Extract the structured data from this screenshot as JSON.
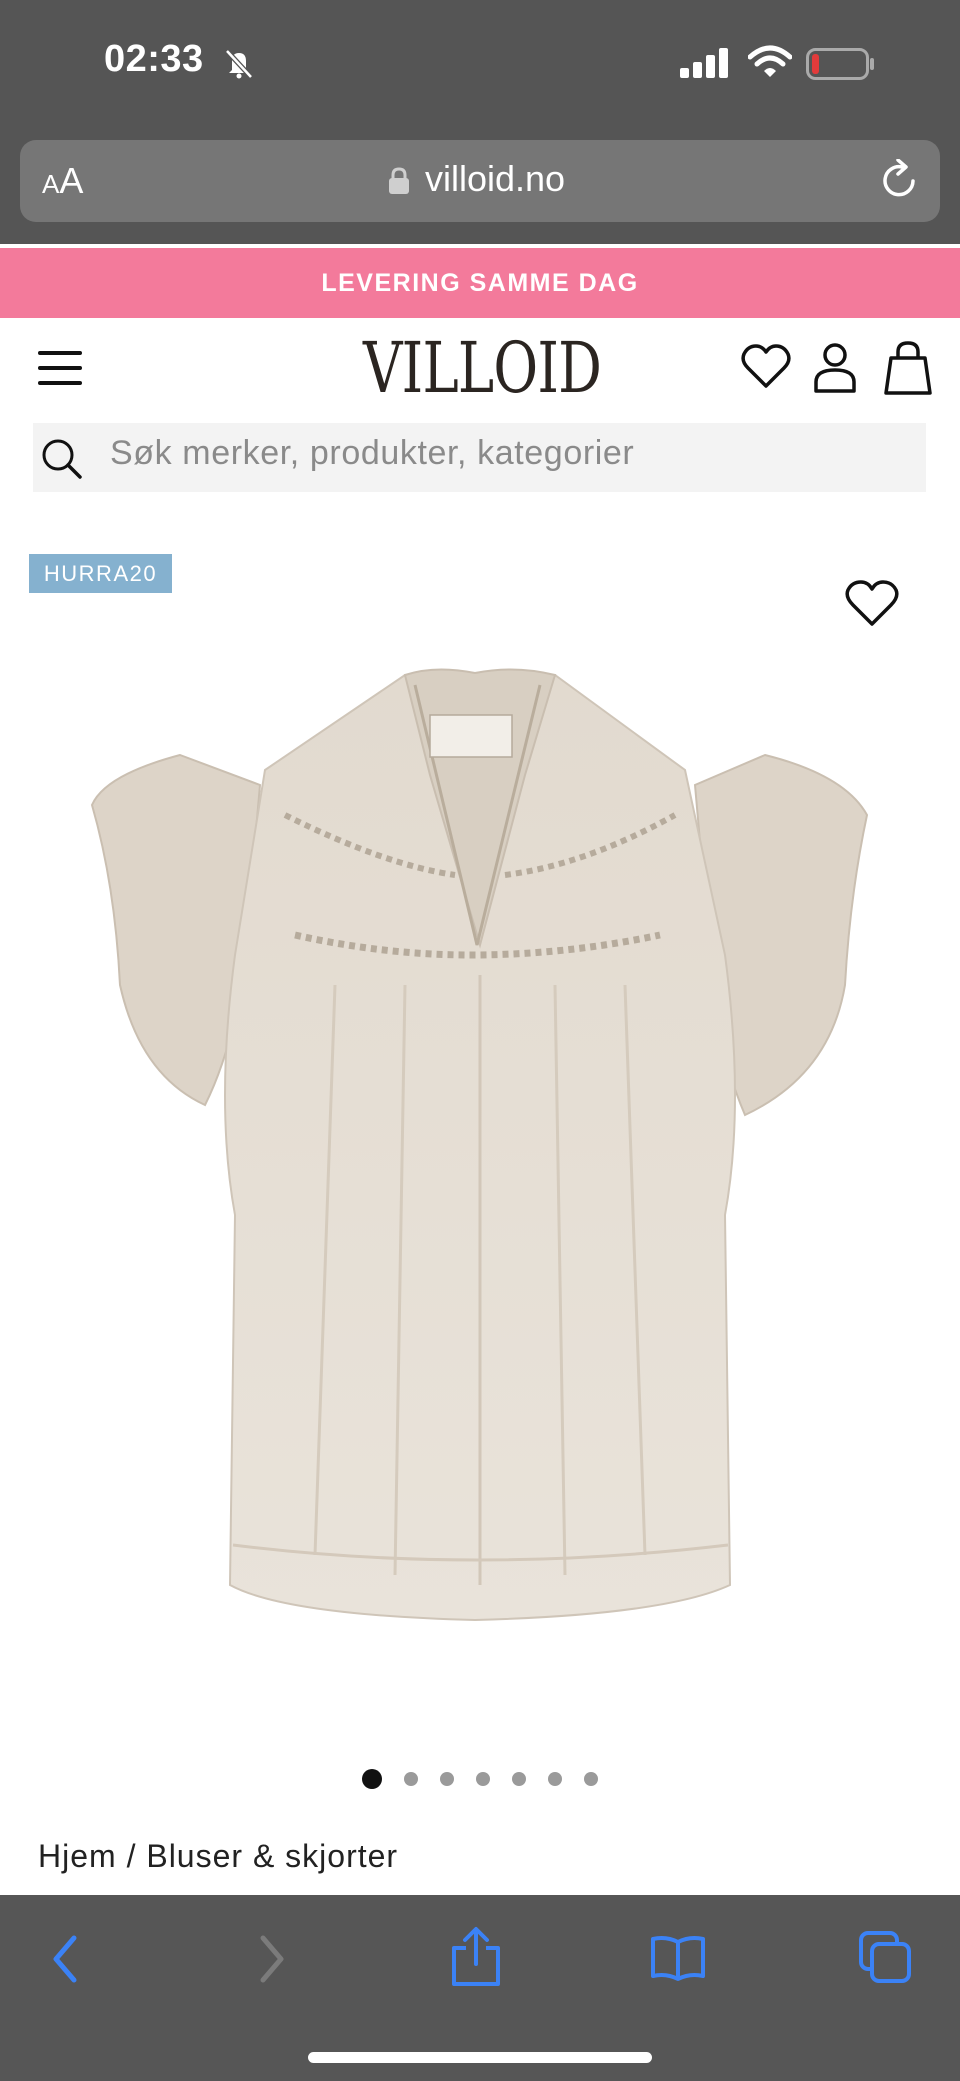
{
  "status_bar": {
    "time": "02:33"
  },
  "browser": {
    "text_size_label_small": "A",
    "text_size_label_large": "A",
    "url": "villoid.no"
  },
  "banner": {
    "text": "LEVERING SAMME DAG"
  },
  "header": {
    "logo": "VILLOID"
  },
  "search": {
    "placeholder": "Søk merker, produkter, kategorier"
  },
  "product": {
    "badge": "HURRA20",
    "image_count": 7,
    "active_image_index": 0
  },
  "breadcrumb": {
    "text": "Hjem / Bluser & skjorter"
  },
  "colors": {
    "banner": "#f37a9b",
    "badge": "#85b1cf",
    "browser_chrome": "#555555",
    "toolbar_icons": "#3b82f6"
  },
  "icons": {
    "status": [
      "bell-slash-icon",
      "cellular-signal-icon",
      "wifi-icon",
      "battery-icon"
    ],
    "browser": [
      "lock-icon",
      "reload-icon"
    ],
    "header": [
      "menu-icon",
      "heart-icon",
      "account-icon",
      "shopping-bag-icon"
    ],
    "toolbar": [
      "back-arrow-icon",
      "forward-arrow-icon",
      "share-icon",
      "bookmarks-icon",
      "tabs-icon"
    ]
  }
}
